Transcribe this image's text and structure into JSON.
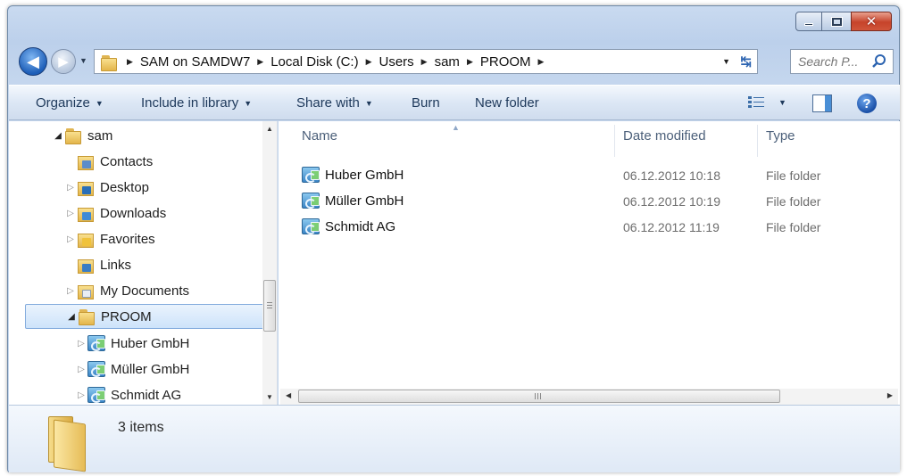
{
  "window": {
    "caption": {
      "minimize": "",
      "maximize": "",
      "close": "✕"
    }
  },
  "address": {
    "back_glyph": "◀",
    "forward_glyph": "▶",
    "crumbs": [
      "SAM on SAMDW7",
      "Local Disk (C:)",
      "Users",
      "sam",
      "PROOM"
    ],
    "search_placeholder": "Search P..."
  },
  "toolbar": {
    "organize": "Organize",
    "include_in_library": "Include in library",
    "share_with": "Share with",
    "burn": "Burn",
    "new_folder": "New folder",
    "help": "?"
  },
  "tree": {
    "items": [
      {
        "label": "sam",
        "level": 0,
        "expander": "open",
        "icon": "folder"
      },
      {
        "label": "Contacts",
        "level": 1,
        "expander": "none",
        "icon": "contacts-folder"
      },
      {
        "label": "Desktop",
        "level": 1,
        "expander": "closed",
        "icon": "desktop-folder"
      },
      {
        "label": "Downloads",
        "level": 1,
        "expander": "closed",
        "icon": "downloads-folder"
      },
      {
        "label": "Favorites",
        "level": 1,
        "expander": "closed",
        "icon": "favorites-folder"
      },
      {
        "label": "Links",
        "level": 1,
        "expander": "none",
        "icon": "links-folder"
      },
      {
        "label": "My Documents",
        "level": 1,
        "expander": "closed",
        "icon": "documents-folder"
      },
      {
        "label": "PROOM",
        "level": 1,
        "expander": "open",
        "icon": "folder",
        "selected": true
      },
      {
        "label": "Huber GmbH",
        "level": 2,
        "expander": "closed",
        "icon": "sync-folder"
      },
      {
        "label": "Müller GmbH",
        "level": 2,
        "expander": "closed",
        "icon": "sync-folder"
      },
      {
        "label": "Schmidt AG",
        "level": 2,
        "expander": "closed",
        "icon": "sync-folder"
      }
    ]
  },
  "columns": {
    "name": "Name",
    "date": "Date modified",
    "type": "Type"
  },
  "files": [
    {
      "name": "Huber GmbH",
      "date": "06.12.2012 10:18",
      "type": "File folder"
    },
    {
      "name": "Müller GmbH",
      "date": "06.12.2012 10:19",
      "type": "File folder"
    },
    {
      "name": "Schmidt AG",
      "date": "06.12.2012 11:19",
      "type": "File folder"
    }
  ],
  "details": {
    "item_count": "3 items"
  },
  "colors": {
    "selection": "#cde3fa",
    "close_button": "#c6432a",
    "accent": "#1e395b"
  }
}
